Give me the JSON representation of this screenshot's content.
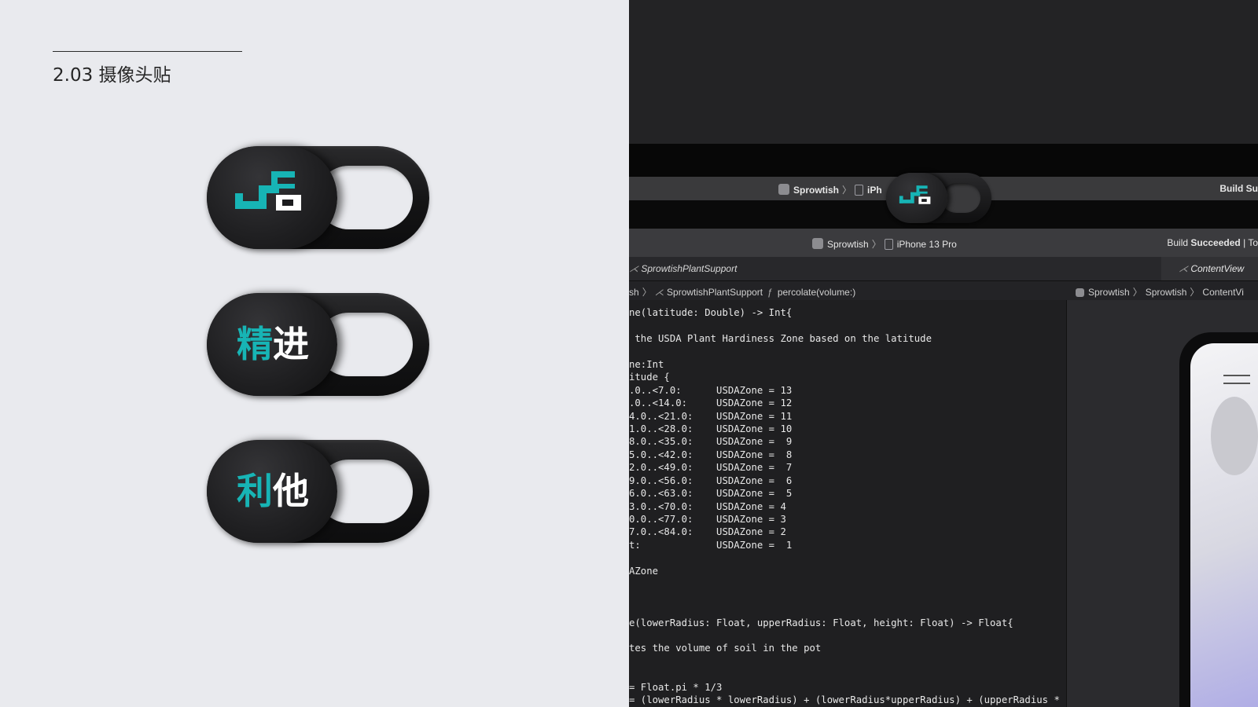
{
  "section": {
    "number_title": "2.03 摄像头贴"
  },
  "covers": [
    {
      "type": "logo",
      "teal": "",
      "white": ""
    },
    {
      "type": "text",
      "teal": "精",
      "white": "进"
    },
    {
      "type": "text",
      "teal": "利",
      "white": "他"
    }
  ],
  "colors": {
    "teal": "#17b4b5",
    "background": "#e9eaee",
    "cover_dark": "#141415"
  },
  "xcode": {
    "top_bar": {
      "scheme": "Sprowtish",
      "device_short": "iPh",
      "status": "Build Su"
    },
    "toolbar": {
      "scheme": "Sprowtish",
      "device": "iPhone 13 Pro",
      "status_prefix": "Build ",
      "status_bold": "Succeeded",
      "status_suffix": " | To"
    },
    "tab_left": "SprowtishPlantSupport",
    "tab_right": "ContentView",
    "jump_left": {
      "a": "sh",
      "b": "SprowtishPlantSupport",
      "c": "percolate(volume:)"
    },
    "jump_right": {
      "a": "Sprowtish",
      "b": "Sprowtish",
      "c": "ContentVi"
    },
    "code_lines": [
      "ne(latitude: Double) -> Int{",
      "",
      " the USDA Plant Hardiness Zone based on the latitude",
      "",
      "ne:Int",
      "itude {",
      ".0..<7.0:      USDAZone = 13",
      ".0..<14.0:     USDAZone = 12",
      "4.0..<21.0:    USDAZone = 11",
      "1.0..<28.0:    USDAZone = 10",
      "8.0..<35.0:    USDAZone =  9",
      "5.0..<42.0:    USDAZone =  8",
      "2.0..<49.0:    USDAZone =  7",
      "9.0..<56.0:    USDAZone =  6",
      "6.0..<63.0:    USDAZone =  5",
      "3.0..<70.0:    USDAZone = 4",
      "0.0..<77.0:    USDAZone = 3",
      "7.0..<84.0:    USDAZone = 2",
      "t:             USDAZone =  1",
      "",
      "AZone",
      "",
      "",
      "",
      "e(lowerRadius: Float, upperRadius: Float, height: Float) -> Float{",
      "",
      "tes the volume of soil in the pot",
      "",
      "",
      "= Float.pi * 1/3",
      "= (lowerRadius * lowerRadius) + (lowerRadius*upperRadius) + (upperRadius *"
    ]
  }
}
